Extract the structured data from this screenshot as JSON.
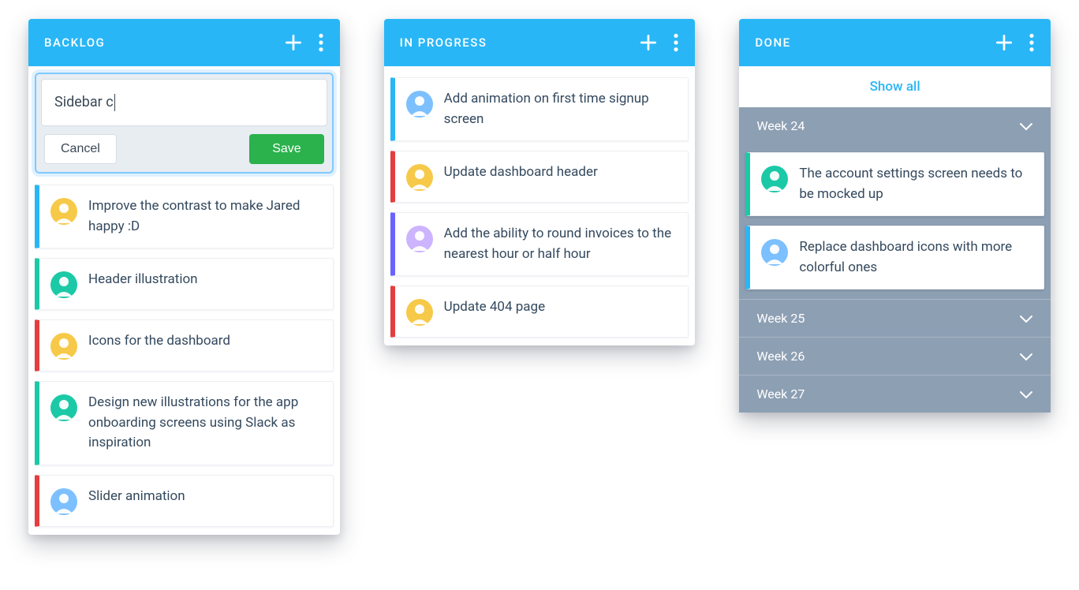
{
  "colors": {
    "header_bg": "#29b6f6",
    "cancel_border": "#d7dde4",
    "save_bg": "#2bb24c",
    "week_bg": "#8d9fb3"
  },
  "columns": {
    "backlog": {
      "title": "BACKLOG",
      "new_card": {
        "input_value": "Sidebar c",
        "cancel_label": "Cancel",
        "save_label": "Save"
      },
      "cards": [
        {
          "stripe": "blue",
          "avatar_bg": "#f7c948",
          "text": "Improve the contrast to make Jared happy :D"
        },
        {
          "stripe": "green",
          "avatar_bg": "#1cc9a7",
          "text": "Header illustration"
        },
        {
          "stripe": "red",
          "avatar_bg": "#f7c948",
          "text": "Icons for the dashboard"
        },
        {
          "stripe": "green",
          "avatar_bg": "#1cc9a7",
          "text": "Design new illustrations for the app onboarding screens using Slack as inspiration"
        },
        {
          "stripe": "red",
          "avatar_bg": "#7cc0ff",
          "text": "Slider animation"
        }
      ]
    },
    "in_progress": {
      "title": "IN PROGRESS",
      "cards": [
        {
          "stripe": "blue",
          "avatar_bg": "#7cc0ff",
          "text": "Add animation on first time signup screen"
        },
        {
          "stripe": "red",
          "avatar_bg": "#f7c948",
          "text": "Update dashboard header"
        },
        {
          "stripe": "indigo",
          "avatar_bg": "#cdb4ff",
          "text": "Add the ability to round invoices to the nearest hour or half hour"
        },
        {
          "stripe": "red",
          "avatar_bg": "#f7c948",
          "text": "Update 404 page"
        }
      ]
    },
    "done": {
      "title": "DONE",
      "show_all_label": "Show all",
      "weeks": [
        {
          "label": "Week 24",
          "expanded": true,
          "cards": [
            {
              "stripe": "green",
              "avatar_bg": "#1cc9a7",
              "text": "The account settings screen needs to be mocked up"
            },
            {
              "stripe": "blue",
              "avatar_bg": "#7cc0ff",
              "text": "Replace dashboard icons with more colorful ones"
            }
          ]
        },
        {
          "label": "Week 25",
          "expanded": false,
          "cards": []
        },
        {
          "label": "Week 26",
          "expanded": false,
          "cards": []
        },
        {
          "label": "Week 27",
          "expanded": false,
          "cards": []
        }
      ]
    }
  }
}
